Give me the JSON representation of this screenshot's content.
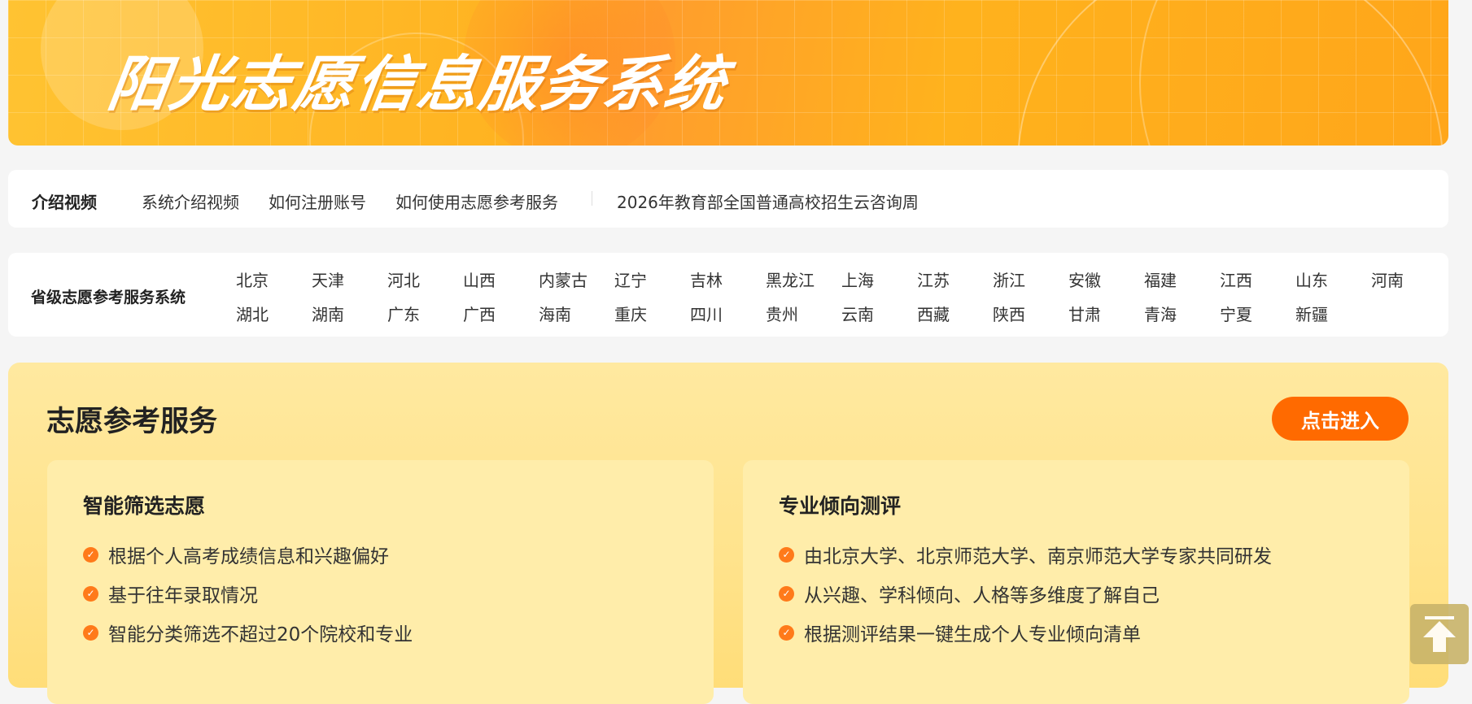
{
  "banner": {
    "title": "阳光志愿信息服务系统"
  },
  "intro": {
    "label": "介绍视频",
    "links": [
      "系统介绍视频",
      "如何注册账号",
      "如何使用志愿参考服务",
      "2026年教育部全国普通高校招生云咨询周"
    ]
  },
  "provinces": {
    "label": "省级志愿参考服务系统",
    "items": [
      "北京",
      "天津",
      "河北",
      "山西",
      "内蒙古",
      "辽宁",
      "吉林",
      "黑龙江",
      "上海",
      "江苏",
      "浙江",
      "安徽",
      "福建",
      "江西",
      "山东",
      "河南",
      "湖北",
      "湖南",
      "广东",
      "广西",
      "海南",
      "重庆",
      "四川",
      "贵州",
      "云南",
      "西藏",
      "陕西",
      "甘肃",
      "青海",
      "宁夏",
      "新疆"
    ]
  },
  "service": {
    "title": "志愿参考服务",
    "enter_label": "点击进入",
    "cards": [
      {
        "title": "智能筛选志愿",
        "points": [
          "根据个人高考成绩信息和兴趣偏好",
          "基于往年录取情况",
          "智能分类筛选不超过20个院校和专业"
        ]
      },
      {
        "title": "专业倾向测评",
        "points": [
          "由北京大学、北京师范大学、南京师范大学专家共同研发",
          "从兴趣、学科倾向、人格等多维度了解自己",
          "根据测评结果一键生成个人专业倾向清单"
        ]
      }
    ]
  },
  "colors": {
    "accent": "#ff6a00",
    "banner": "#ffb321",
    "panel": "#ffe38c"
  },
  "icons": {
    "check": "check-circle-icon",
    "back_to_top": "arrow-up-icon"
  }
}
